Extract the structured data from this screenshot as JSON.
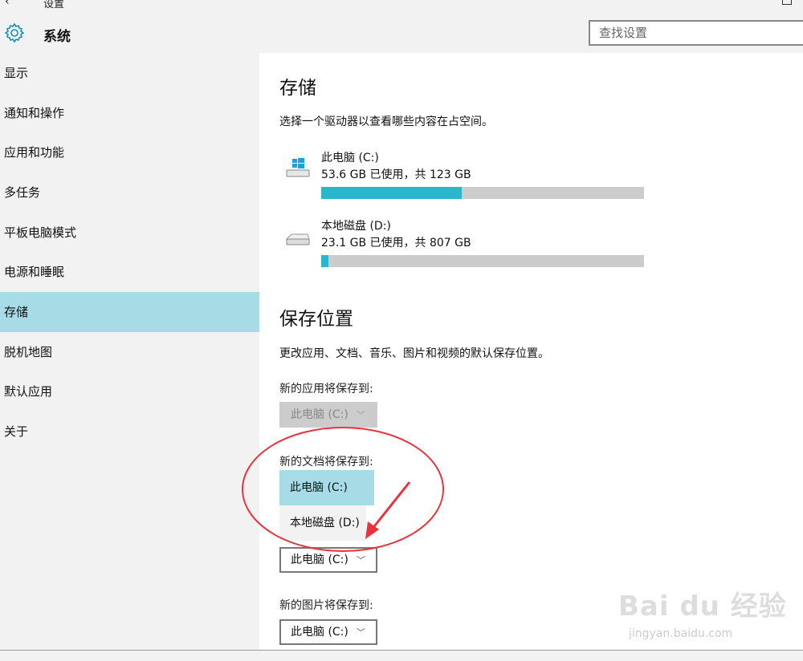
{
  "window": {
    "back_glyph": "‹",
    "title": "设置"
  },
  "header": {
    "app_title": "系统",
    "search_placeholder": "查找设置"
  },
  "sidebar": {
    "items": [
      {
        "label": "显示"
      },
      {
        "label": "通知和操作"
      },
      {
        "label": "应用和功能"
      },
      {
        "label": "多任务"
      },
      {
        "label": "平板电脑模式"
      },
      {
        "label": "电源和睡眠"
      },
      {
        "label": "存储",
        "selected": true
      },
      {
        "label": "脱机地图"
      },
      {
        "label": "默认应用"
      },
      {
        "label": "关于"
      }
    ]
  },
  "storage": {
    "title": "存储",
    "description": "选择一个驱动器以查看哪些内容在占空间。",
    "drives": [
      {
        "name": "此电脑 (C:)",
        "usage": "53.6 GB 已使用，共 123 GB",
        "used_fraction": 0.435,
        "icon": "windows-drive-icon"
      },
      {
        "name": "本地磁盘 (D:)",
        "usage": "23.1 GB 已使用，共 807 GB",
        "used_fraction": 0.022,
        "icon": "disk-drive-icon"
      }
    ]
  },
  "save_locations": {
    "title": "保存位置",
    "description": "更改应用、文档、音乐、图片和视频的默认保存位置。",
    "apps": {
      "label": "新的应用将保存到:",
      "value": "此电脑 (C:)"
    },
    "documents": {
      "label": "新的文档将保存到:",
      "options": [
        "此电脑 (C:)",
        "本地磁盘 (D:)"
      ],
      "selected": "此电脑 (C:)"
    },
    "music": {
      "label_peek": "]:",
      "value": "此电脑 (C:)"
    },
    "pictures": {
      "label": "新的图片将保存到:",
      "value": "此电脑 (C:)"
    }
  },
  "annotation": {
    "color": "#e8323c"
  },
  "watermark": {
    "brand": "Bai du 经验",
    "site": "jingyan.baidu.com"
  }
}
